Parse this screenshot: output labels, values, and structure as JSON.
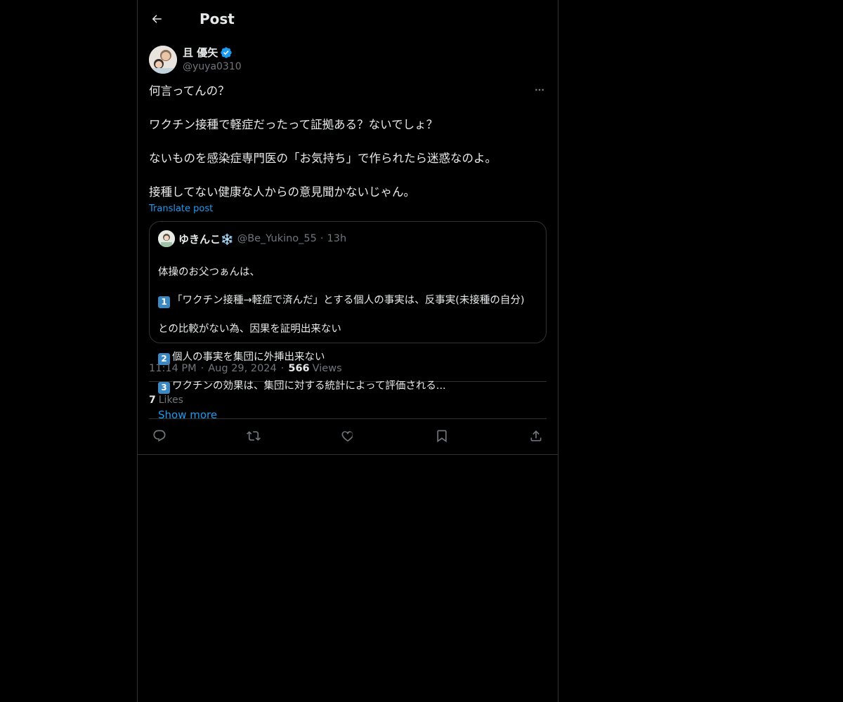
{
  "header": {
    "title": "Post",
    "back_icon": "arrow-left-icon"
  },
  "author": {
    "display_name": "且 優矢",
    "handle": "@yuya0310",
    "verified": true,
    "accent_color": "#1d9bf0"
  },
  "post": {
    "text": "何言ってんの？\n\nワクチン接種で軽症だったって証拠ある？ないでしょ？\n\nないものを感染症専門医の「お気持ち」で作られたら迷惑なのよ。\n\n接種してない健康な人からの意見聞かないじゃん。",
    "translate_label": "Translate post"
  },
  "quote": {
    "display_name": "ゆきんこ❄️",
    "handle": "@Be_Yukino_55",
    "time": "13h",
    "line1": "体操のお父つぁんは、",
    "item1_num": "1",
    "item1_text": "「ワクチン接種→軽症で済んだ」とする個人の事実は、反事実(未接種の自分)",
    "item1_cont": "との比較がない為、因果を証明出来ない",
    "item2_num": "2",
    "item2_text": "個人の事実を集団に外挿出来ない",
    "item3_num": "3",
    "item3_text": "ワクチンの効果は、集団に対する統計によって評価される...",
    "show_more": "Show more"
  },
  "meta": {
    "time": "11:14 PM",
    "date": "Aug 29, 2024",
    "separator": "·",
    "views_count": "566",
    "views_label": "Views"
  },
  "stats": {
    "likes_count": "7",
    "likes_label": "Likes"
  },
  "actions": [
    "reply-icon",
    "repost-icon",
    "like-icon",
    "bookmark-icon",
    "share-icon"
  ]
}
